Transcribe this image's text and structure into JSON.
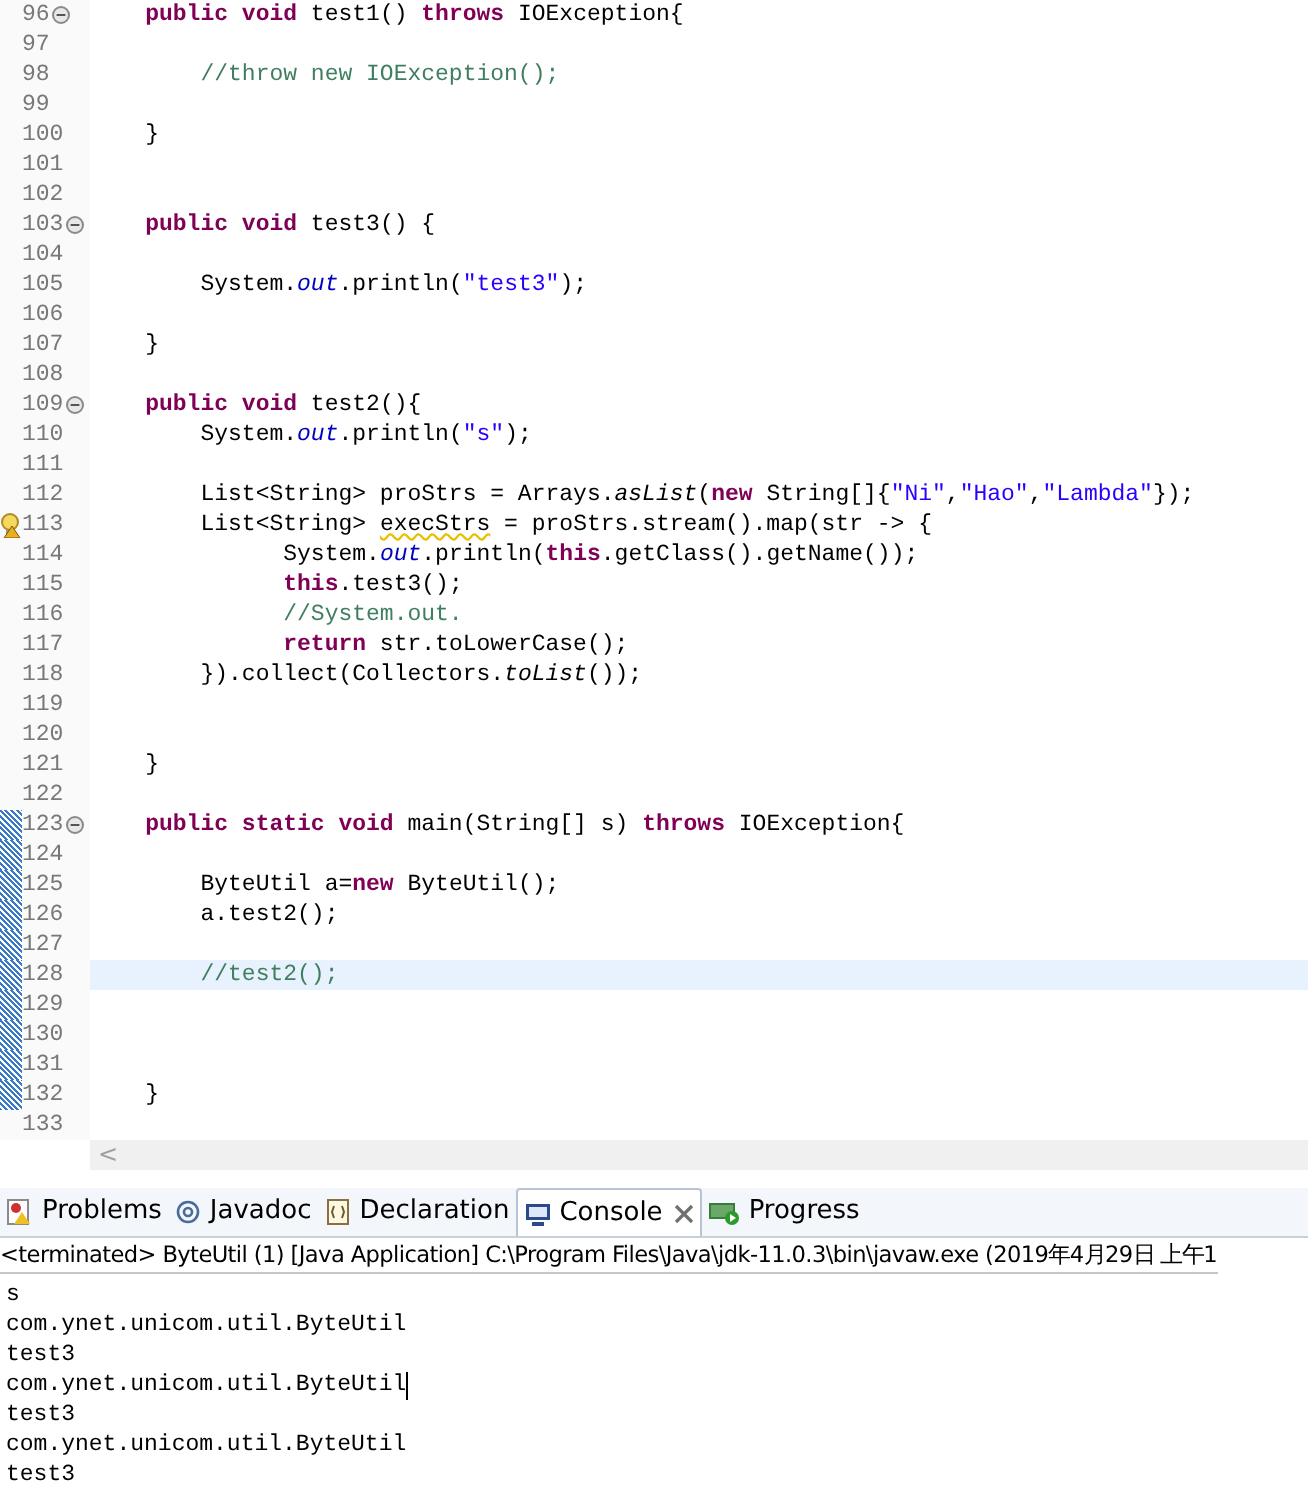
{
  "editor": {
    "lines": [
      {
        "number": "96",
        "fold": true,
        "warning": false,
        "marked": false,
        "current": false,
        "tokens": [
          {
            "kind": "keyword",
            "text": "    public void"
          },
          {
            "kind": "plain",
            "text": " test1() "
          },
          {
            "kind": "keyword",
            "text": "throws"
          },
          {
            "kind": "plain",
            "text": " IOException{"
          }
        ]
      },
      {
        "number": "97",
        "fold": false,
        "warning": false,
        "marked": false,
        "current": false
      },
      {
        "number": "98",
        "fold": false,
        "warning": false,
        "marked": false,
        "current": false,
        "tokens": [
          {
            "kind": "comment",
            "text": "        //throw new IOException();"
          }
        ]
      },
      {
        "number": "99",
        "fold": false,
        "warning": false,
        "marked": false,
        "current": false
      },
      {
        "number": "100",
        "fold": false,
        "warning": false,
        "marked": false,
        "current": false,
        "tokens": [
          {
            "kind": "plain",
            "text": "    }"
          }
        ]
      },
      {
        "number": "101",
        "fold": false,
        "warning": false,
        "marked": false,
        "current": false
      },
      {
        "number": "102",
        "fold": false,
        "warning": false,
        "marked": false,
        "current": false
      },
      {
        "number": "103",
        "fold": true,
        "warning": false,
        "marked": false,
        "current": false,
        "tokens": [
          {
            "kind": "keyword",
            "text": "    public void"
          },
          {
            "kind": "plain",
            "text": " test3() {"
          }
        ]
      },
      {
        "number": "104",
        "fold": false,
        "warning": false,
        "marked": false,
        "current": false
      },
      {
        "number": "105",
        "fold": false,
        "warning": false,
        "marked": false,
        "current": false,
        "tokens": [
          {
            "kind": "plain",
            "text": "        System."
          },
          {
            "kind": "field",
            "text": "out"
          },
          {
            "kind": "plain",
            "text": ".println("
          },
          {
            "kind": "string",
            "text": "\"test3\""
          },
          {
            "kind": "plain",
            "text": ");"
          }
        ]
      },
      {
        "number": "106",
        "fold": false,
        "warning": false,
        "marked": false,
        "current": false
      },
      {
        "number": "107",
        "fold": false,
        "warning": false,
        "marked": false,
        "current": false,
        "tokens": [
          {
            "kind": "plain",
            "text": "    }"
          }
        ]
      },
      {
        "number": "108",
        "fold": false,
        "warning": false,
        "marked": false,
        "current": false
      },
      {
        "number": "109",
        "fold": true,
        "warning": false,
        "marked": false,
        "current": false,
        "tokens": [
          {
            "kind": "keyword",
            "text": "    public void"
          },
          {
            "kind": "plain",
            "text": " test2(){"
          }
        ]
      },
      {
        "number": "110",
        "fold": false,
        "warning": false,
        "marked": false,
        "current": false,
        "tokens": [
          {
            "kind": "plain",
            "text": "        System."
          },
          {
            "kind": "field",
            "text": "out"
          },
          {
            "kind": "plain",
            "text": ".println("
          },
          {
            "kind": "string",
            "text": "\"s\""
          },
          {
            "kind": "plain",
            "text": ");"
          }
        ]
      },
      {
        "number": "111",
        "fold": false,
        "warning": false,
        "marked": false,
        "current": false
      },
      {
        "number": "112",
        "fold": false,
        "warning": false,
        "marked": false,
        "current": false,
        "tokens": [
          {
            "kind": "plain",
            "text": "        List<String> proStrs = Arrays."
          },
          {
            "kind": "method",
            "text": "asList"
          },
          {
            "kind": "plain",
            "text": "("
          },
          {
            "kind": "keyword",
            "text": "new"
          },
          {
            "kind": "plain",
            "text": " String[]{"
          },
          {
            "kind": "string",
            "text": "\"Ni\""
          },
          {
            "kind": "plain",
            "text": ","
          },
          {
            "kind": "string",
            "text": "\"Hao\""
          },
          {
            "kind": "plain",
            "text": ","
          },
          {
            "kind": "string",
            "text": "\"Lambda\""
          },
          {
            "kind": "plain",
            "text": "});"
          }
        ]
      },
      {
        "number": "113",
        "fold": false,
        "warning": true,
        "marked": false,
        "current": false,
        "tokens": [
          {
            "kind": "plain",
            "text": "        List<String> "
          },
          {
            "kind": "warned",
            "text": "execStrs"
          },
          {
            "kind": "plain",
            "text": " = proStrs.stream().map(str -> {"
          }
        ]
      },
      {
        "number": "114",
        "fold": false,
        "warning": false,
        "marked": false,
        "current": false,
        "tokens": [
          {
            "kind": "plain",
            "text": "              System."
          },
          {
            "kind": "field",
            "text": "out"
          },
          {
            "kind": "plain",
            "text": ".println("
          },
          {
            "kind": "keyword",
            "text": "this"
          },
          {
            "kind": "plain",
            "text": ".getClass().getName());"
          }
        ]
      },
      {
        "number": "115",
        "fold": false,
        "warning": false,
        "marked": false,
        "current": false,
        "tokens": [
          {
            "kind": "keyword",
            "text": "              this"
          },
          {
            "kind": "plain",
            "text": ".test3();"
          }
        ]
      },
      {
        "number": "116",
        "fold": false,
        "warning": false,
        "marked": false,
        "current": false,
        "tokens": [
          {
            "kind": "comment",
            "text": "              //System.out."
          }
        ]
      },
      {
        "number": "117",
        "fold": false,
        "warning": false,
        "marked": false,
        "current": false,
        "tokens": [
          {
            "kind": "keyword",
            "text": "              return"
          },
          {
            "kind": "plain",
            "text": " str.toLowerCase();"
          }
        ]
      },
      {
        "number": "118",
        "fold": false,
        "warning": false,
        "marked": false,
        "current": false,
        "tokens": [
          {
            "kind": "plain",
            "text": "        }).collect(Collectors."
          },
          {
            "kind": "method",
            "text": "toList"
          },
          {
            "kind": "plain",
            "text": "());"
          }
        ]
      },
      {
        "number": "119",
        "fold": false,
        "warning": false,
        "marked": false,
        "current": false
      },
      {
        "number": "120",
        "fold": false,
        "warning": false,
        "marked": false,
        "current": false
      },
      {
        "number": "121",
        "fold": false,
        "warning": false,
        "marked": false,
        "current": false,
        "tokens": [
          {
            "kind": "plain",
            "text": "    }"
          }
        ]
      },
      {
        "number": "122",
        "fold": false,
        "warning": false,
        "marked": false,
        "current": false
      },
      {
        "number": "123",
        "fold": true,
        "warning": false,
        "marked": true,
        "current": false,
        "tokens": [
          {
            "kind": "keyword",
            "text": "    public static void"
          },
          {
            "kind": "plain",
            "text": " main(String[] s) "
          },
          {
            "kind": "keyword",
            "text": "throws"
          },
          {
            "kind": "plain",
            "text": " IOException{"
          }
        ]
      },
      {
        "number": "124",
        "fold": false,
        "warning": false,
        "marked": true,
        "current": false
      },
      {
        "number": "125",
        "fold": false,
        "warning": false,
        "marked": true,
        "current": false,
        "tokens": [
          {
            "kind": "plain",
            "text": "        ByteUtil a="
          },
          {
            "kind": "keyword",
            "text": "new"
          },
          {
            "kind": "plain",
            "text": " ByteUtil();"
          }
        ]
      },
      {
        "number": "126",
        "fold": false,
        "warning": false,
        "marked": true,
        "current": false,
        "tokens": [
          {
            "kind": "plain",
            "text": "        a.test2();"
          }
        ]
      },
      {
        "number": "127",
        "fold": false,
        "warning": false,
        "marked": true,
        "current": false
      },
      {
        "number": "128",
        "fold": false,
        "warning": false,
        "marked": true,
        "current": true,
        "tokens": [
          {
            "kind": "comment",
            "text": "        //test2();"
          }
        ]
      },
      {
        "number": "129",
        "fold": false,
        "warning": false,
        "marked": true,
        "current": false
      },
      {
        "number": "130",
        "fold": false,
        "warning": false,
        "marked": true,
        "current": false
      },
      {
        "number": "131",
        "fold": false,
        "warning": false,
        "marked": true,
        "current": false
      },
      {
        "number": "132",
        "fold": false,
        "warning": false,
        "marked": true,
        "current": false,
        "tokens": [
          {
            "kind": "plain",
            "text": "    }"
          }
        ]
      },
      {
        "number": "133",
        "fold": false,
        "warning": false,
        "marked": false,
        "current": false
      }
    ],
    "scroll_left": "<"
  },
  "panel": {
    "tabs": [
      {
        "label": "Problems",
        "kind": "problems",
        "selected": false,
        "closable": false
      },
      {
        "label": "Javadoc",
        "kind": "at",
        "selected": false,
        "closable": false
      },
      {
        "label": "Declaration",
        "kind": "declaration",
        "selected": false,
        "closable": false
      },
      {
        "label": "Console",
        "kind": "console",
        "selected": true,
        "closable": true
      },
      {
        "label": "Progress",
        "kind": "progress",
        "selected": false,
        "closable": false
      }
    ],
    "status": "<terminated> ByteUtil (1) [Java Application] C:\\Program Files\\Java\\jdk-11.0.3\\bin\\javaw.exe (2019年4月29日 上午1",
    "output": [
      {
        "text": "s",
        "cursor": false
      },
      {
        "text": "com.ynet.unicom.util.ByteUtil",
        "cursor": false
      },
      {
        "text": "test3",
        "cursor": false
      },
      {
        "text": "com.ynet.unicom.util.ByteUtil",
        "cursor": true
      },
      {
        "text": "test3",
        "cursor": false
      },
      {
        "text": "com.ynet.unicom.util.ByteUtil",
        "cursor": false
      },
      {
        "text": "test3",
        "cursor": false
      }
    ]
  }
}
